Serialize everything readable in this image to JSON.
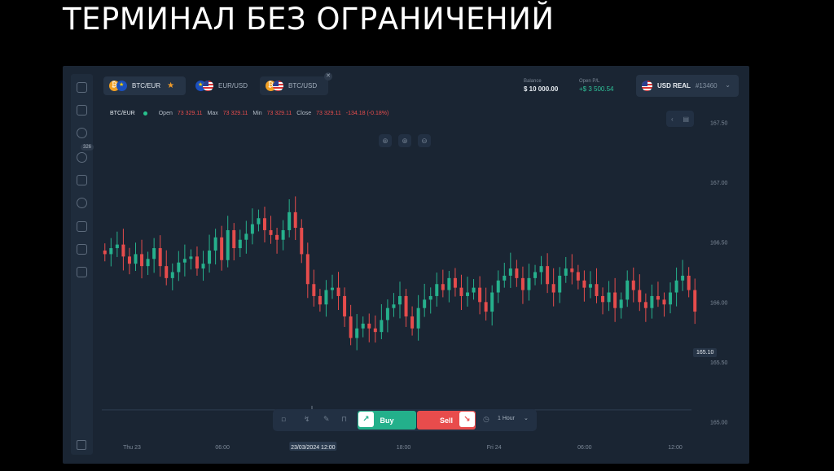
{
  "headline": "ТЕРМИНАЛ БЕЗ ОГРАНИЧЕНИЙ",
  "sidebar": {
    "badge": "326",
    "icons": [
      "dashboard-icon",
      "chart-icon",
      "market-icon",
      "history-icon",
      "book-icon",
      "settings-icon",
      "chat-icon",
      "bank-icon",
      "calculator-icon"
    ]
  },
  "tabs": [
    {
      "label": "BTC/EUR",
      "coins": [
        "btc",
        "eur"
      ],
      "active": true,
      "starred": true
    },
    {
      "label": "EUR/USD",
      "coins": [
        "eur",
        "usd"
      ],
      "active": false
    },
    {
      "label": "BTC/USD",
      "coins": [
        "btc",
        "usd"
      ],
      "active": false,
      "closable": true
    }
  ],
  "stats": {
    "balance_label": "Balance",
    "balance_value": "$ 10 000.00",
    "pnl_label": "Open P/L",
    "pnl_value": "+$ 3 500.54"
  },
  "account": {
    "name": "USD REAL",
    "id": "#13460"
  },
  "ohlc": {
    "symbol": "BTC/EUR",
    "open_label": "Open",
    "open": "73 329.11",
    "max_label": "Max",
    "max": "73 329.11",
    "min_label": "Min",
    "min": "73 329.11",
    "close_label": "Close",
    "close": "73 329.11",
    "change": "-134.18 (-0.18%)"
  },
  "trade": {
    "buy": "Buy",
    "sell": "Sell",
    "timeframe": "1 Hour"
  },
  "current_price": "165.10",
  "colors": {
    "up": "#26b08c",
    "down": "#e54c4c",
    "bg": "#1a2533"
  },
  "chart_data": {
    "type": "candlestick",
    "y_ticks": [
      "167.50",
      "167.00",
      "166.50",
      "166.00",
      "165.50",
      "165.00"
    ],
    "ylim": [
      164.97,
      167.53
    ],
    "x_ticks": [
      "Thu 23",
      "06:00",
      "23/03/2024 12:00",
      "18:00",
      "Fri 24",
      "06:00",
      "12:00"
    ],
    "highlighted_x_tick": "23/03/2024 12:00",
    "closes": [
      166.4,
      166.45,
      166.48,
      166.38,
      166.32,
      166.4,
      166.3,
      166.36,
      166.45,
      166.3,
      166.2,
      166.25,
      166.33,
      166.36,
      166.38,
      166.28,
      166.32,
      166.43,
      166.54,
      166.35,
      166.6,
      166.45,
      166.52,
      166.57,
      166.65,
      166.7,
      166.6,
      166.56,
      166.52,
      166.6,
      166.75,
      166.62,
      166.4,
      166.15,
      166.05,
      165.98,
      166.1,
      166.12,
      166.05,
      165.88,
      165.7,
      165.78,
      165.82,
      165.78,
      165.75,
      165.85,
      165.95,
      165.98,
      166.05,
      165.88,
      165.78,
      165.95,
      166.02,
      166.05,
      166.15,
      166.1,
      166.2,
      166.12,
      166.05,
      166.08,
      166.12,
      166.0,
      165.92,
      166.08,
      166.18,
      166.22,
      166.28,
      166.2,
      166.1,
      166.2,
      166.25,
      166.3,
      166.15,
      166.08,
      166.22,
      166.28,
      166.25,
      166.18,
      166.12,
      166.15,
      166.05,
      166.0,
      166.08,
      165.95,
      166.02,
      166.18,
      166.1,
      166.0,
      165.95,
      166.05,
      166.02,
      165.98,
      166.08,
      166.18,
      166.22,
      166.1,
      165.92
    ]
  }
}
